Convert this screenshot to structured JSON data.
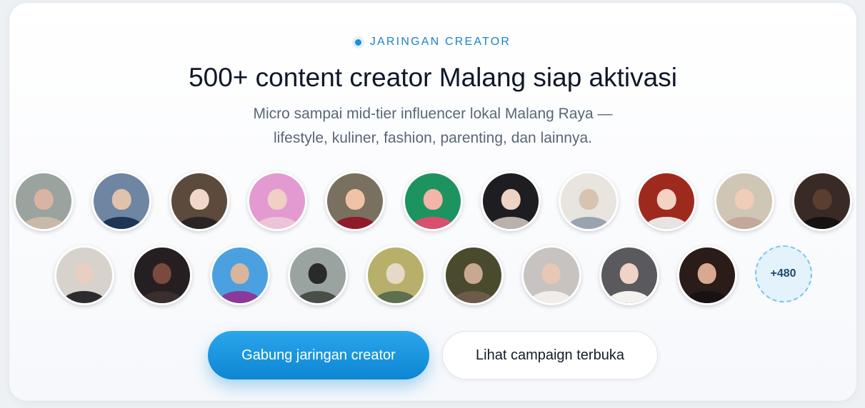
{
  "eyebrow": "JARINGAN CREATOR",
  "title": "500+ content creator Malang siap aktivasi",
  "subtitle_line1": "Micro sampai mid-tier influencer lokal Malang Raya —",
  "subtitle_line2": "lifestyle, kuliner, fashion, parenting, dan lainnya.",
  "more_count": "+480",
  "buttons": {
    "primary": "Gabung jaringan creator",
    "secondary": "Lihat campaign terbuka"
  },
  "colors": {
    "accent": "#1b8fd6",
    "primary_button": "#1a96e0"
  },
  "avatars_row1": [
    {
      "bg": "#9aa39e",
      "face": "#d9b3a4",
      "body": "#c9b9a8"
    },
    {
      "bg": "#6f86a3",
      "face": "#e0c2ad",
      "body": "#1f3556"
    },
    {
      "bg": "#5c4a3c",
      "face": "#f0d7c8",
      "body": "#2a2424"
    },
    {
      "bg": "#e29ad0",
      "face": "#f0cfc4",
      "body": "#ecc4d8"
    },
    {
      "bg": "#7a7060",
      "face": "#f0c3a6",
      "body": "#8f1b2a"
    },
    {
      "bg": "#1d9460",
      "face": "#f2b5a8",
      "body": "#d94f6e"
    },
    {
      "bg": "#1e1e22",
      "face": "#edd2c6",
      "body": "#b9b2ac"
    },
    {
      "bg": "#e8e4de",
      "face": "#d8c2b0",
      "body": "#9aa4b0"
    },
    {
      "bg": "#9e2a1e",
      "face": "#f2d3c4",
      "body": "#e8e4e4"
    },
    {
      "bg": "#cfc6b5",
      "face": "#f0cdb9",
      "body": "#c4a89a"
    },
    {
      "bg": "#3a2a26",
      "face": "#5a3f30",
      "body": "#151212"
    }
  ],
  "avatars_row2": [
    {
      "bg": "#d7d2cc",
      "face": "#e8cfc2",
      "body": "#2c2b2d"
    },
    {
      "bg": "#261f22",
      "face": "#7a4a3e",
      "body": "#3a2e2e"
    },
    {
      "bg": "#4ba1e0",
      "face": "#d9b59c",
      "body": "#8a3a9a"
    },
    {
      "bg": "#9aa3a0",
      "face": "#2b2a2a",
      "body": "#4a4e48"
    },
    {
      "bg": "#b8b06a",
      "face": "#e6d9c8",
      "body": "#5d7050"
    },
    {
      "bg": "#4a4a2e",
      "face": "#c9a891",
      "body": "#6e5a48"
    },
    {
      "bg": "#c6c3c0",
      "face": "#e8c7b4",
      "body": "#f2ecea"
    },
    {
      "bg": "#5a5a5e",
      "face": "#f0d2c6",
      "body": "#f4f2ee"
    },
    {
      "bg": "#2a1c18",
      "face": "#d9a890",
      "body": "#181212"
    }
  ]
}
